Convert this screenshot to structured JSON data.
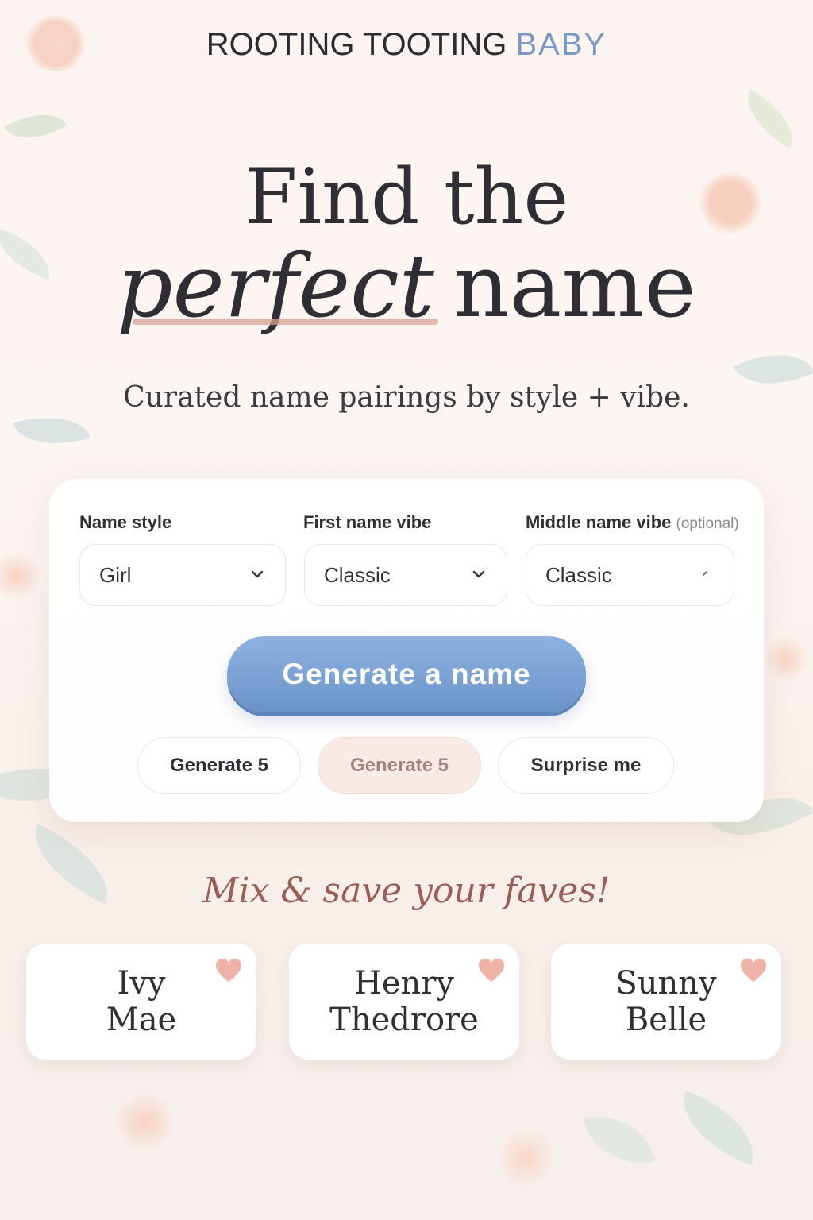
{
  "brand": {
    "name_main": "ROOTING TOOTING",
    "name_accent": "BABY"
  },
  "hero": {
    "line1": "Find the",
    "script_word": "perfect",
    "word2": "name",
    "subtitle": "Curated name pairings by style + vibe."
  },
  "form": {
    "name_style": {
      "label": "Name style",
      "value": "Girl"
    },
    "first_vibe": {
      "label": "First name vibe",
      "value": "Classic"
    },
    "middle_vibe": {
      "label": "Middle name vibe",
      "optional": "(optional)",
      "value": "Classic"
    },
    "generate_label": "Generate a name",
    "chips": [
      "Generate 5",
      "Generate 5",
      "Surprise me"
    ]
  },
  "faves": {
    "title": "Mix & save your faves!",
    "cards": [
      {
        "first": "Ivy",
        "middle": "Mae"
      },
      {
        "first": "Henry",
        "middle": "Thedrore"
      },
      {
        "first": "Sunny",
        "middle": "Belle"
      }
    ]
  },
  "icons": {
    "dropdown": "chevron-down-icon",
    "favorite": "heart-icon"
  },
  "colors": {
    "accent_blue": "#7a98c6",
    "heart": "#f0b1a6",
    "script_title": "#9b5e56"
  }
}
